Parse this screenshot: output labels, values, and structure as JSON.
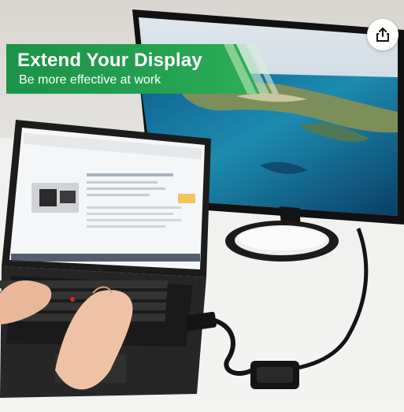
{
  "banner": {
    "title": "Extend Your Display",
    "subtitle": "Be more effective at work"
  },
  "share_button": {
    "icon": "share-icon"
  },
  "colors": {
    "banner_green": "#1e9a4c",
    "banner_stripe": "#8fd39a",
    "monitor_frame": "#1a1a1a",
    "sea_blue": "#1c7fa6",
    "laptop_body": "#222222"
  }
}
